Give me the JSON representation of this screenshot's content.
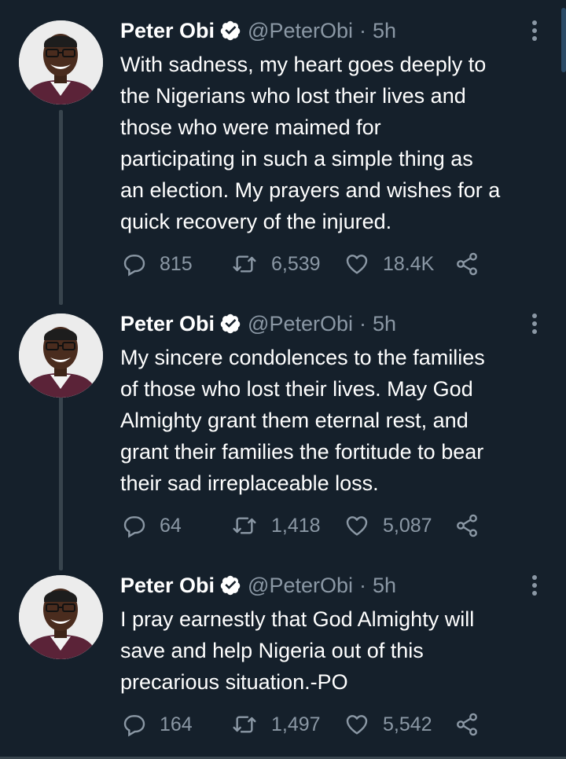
{
  "author": {
    "name": "Peter Obi",
    "handle": "@PeterObi",
    "separator": "·"
  },
  "colors": {
    "background": "#15202b",
    "text_primary": "#ffffff",
    "text_secondary": "#8b98a5",
    "verified_badge": "#ffffff",
    "thread_line": "#38444d"
  },
  "icons": {
    "reply": "reply-icon",
    "retweet": "retweet-icon",
    "like": "like-icon",
    "share": "share-icon",
    "more": "more-vertical-icon",
    "verified": "verified-badge-icon"
  },
  "tweets": [
    {
      "time": "5h",
      "text_lines": [
        "With sadness, my heart goes deeply to",
        "the Nigerians who lost their lives and",
        "those who were maimed for",
        "participating in such a simple thing as",
        "an election. My prayers and wishes for a",
        "quick recovery of the injured."
      ],
      "replies": "815",
      "retweets": "6,539",
      "likes": "18.4K"
    },
    {
      "time": "5h",
      "text_lines": [
        "My sincere condolences to the families",
        "of those who lost their lives. May God",
        "Almighty grant them eternal rest, and",
        "grant their families the fortitude to bear",
        "their sad irreplaceable loss."
      ],
      "replies": "64",
      "retweets": "1,418",
      "likes": "5,087"
    },
    {
      "time": "5h",
      "text_lines": [
        "I pray earnestly that God Almighty will",
        "save and help Nigeria out of this",
        "precarious situation.-PO"
      ],
      "replies": "164",
      "retweets": "1,497",
      "likes": "5,542"
    }
  ]
}
